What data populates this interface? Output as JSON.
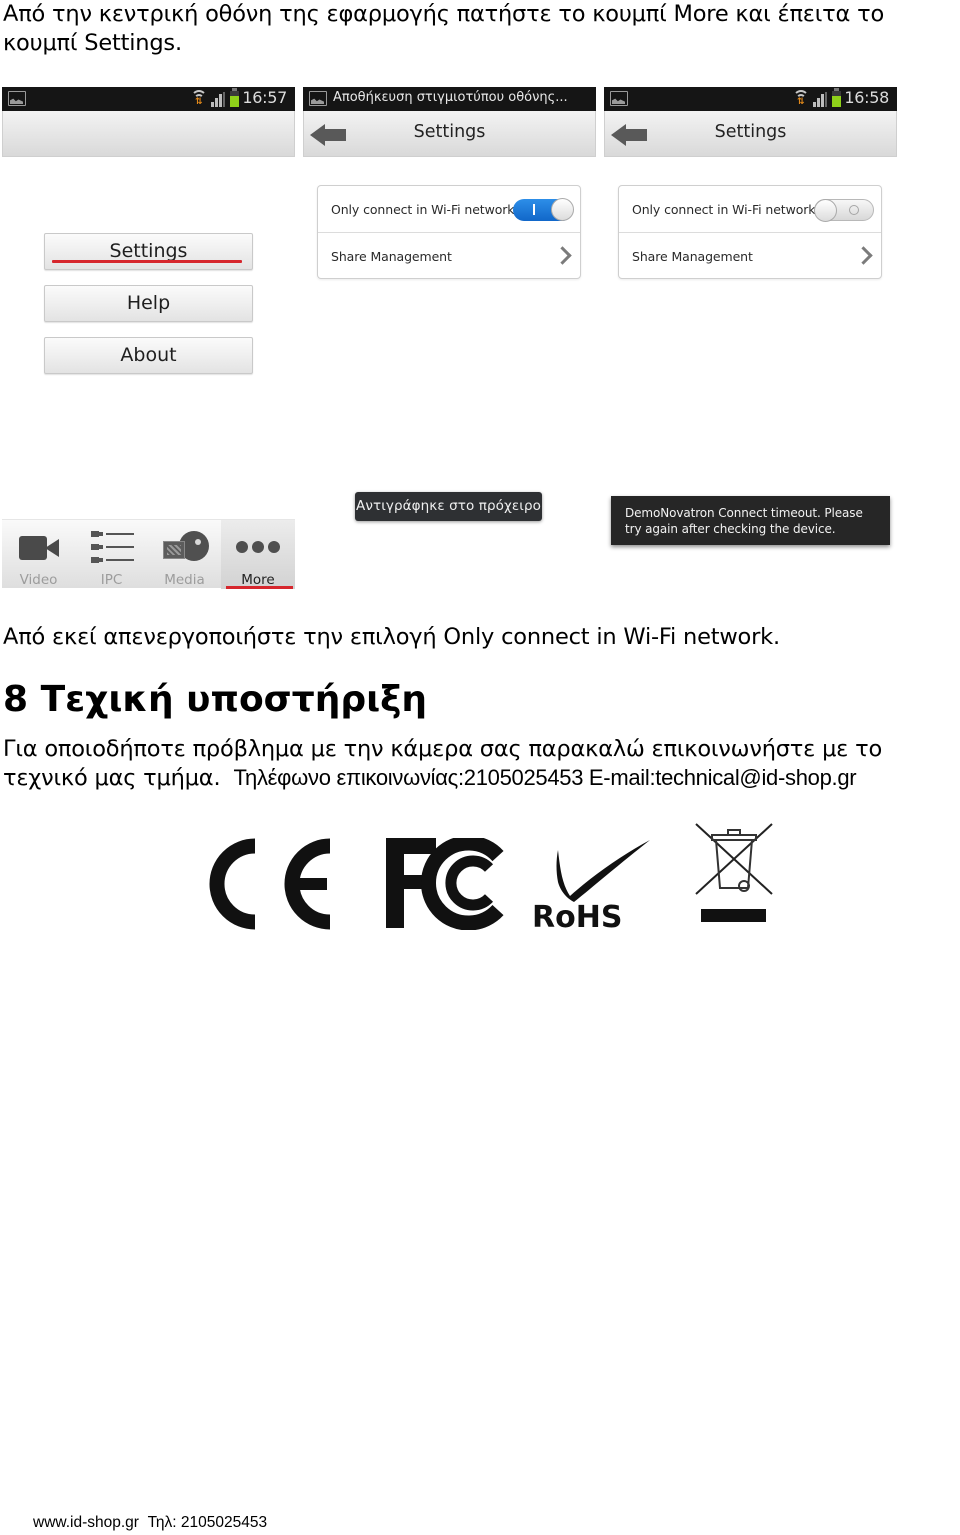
{
  "intro_text_line1": "Από την κεντρική οθόνη της εφαρμογής πατήστε το κουμπί More και έπειτα το",
  "intro_text_line2": "κουμπί Settings.",
  "screens": {
    "screen1": {
      "status_time": "16:57",
      "menu_buttons": [
        {
          "label": "Settings",
          "highlighted": true
        },
        {
          "label": "Help",
          "highlighted": false
        },
        {
          "label": "About",
          "highlighted": false
        }
      ],
      "tabs": [
        {
          "label": "Video",
          "icon": "video-camera-icon",
          "active": false
        },
        {
          "label": "IPC",
          "icon": "camera-list-icon",
          "active": false
        },
        {
          "label": "Media",
          "icon": "media-icon",
          "active": false
        },
        {
          "label": "More",
          "icon": "more-dots-icon",
          "active": true
        }
      ]
    },
    "screen2": {
      "notification_text": "Αποθήκευση στιγμιοτύπου οθόνης...",
      "title": "Settings",
      "rows": [
        {
          "label": "Only connect in Wi-Fi network",
          "type": "toggle",
          "value": true
        },
        {
          "label": "Share Management",
          "type": "link"
        }
      ],
      "toast": "Αντιγράφηκε στο πρόχειρο"
    },
    "screen3": {
      "status_time": "16:58",
      "title": "Settings",
      "rows": [
        {
          "label": "Only connect in Wi-Fi network",
          "type": "toggle",
          "value": false
        },
        {
          "label": "Share Management",
          "type": "link"
        }
      ],
      "toast_line1": "DemoNovatron  Connect timeout. Please",
      "toast_line2": "try again after checking the device."
    }
  },
  "instruction_text": "Από εκεί απενεργοποιήστε την επιλογή Only connect in Wi-Fi network.",
  "section": {
    "heading": "8 Τεχική υποστήριξη",
    "body_line1": "Για οποιοδήποτε πρόβλημα με την κάμερα σας παρακαλώ επικοινωνήστε με το",
    "body_line2": "τεχνικό μας τμήμα.",
    "contact": "Τηλέφωνο επικοινωνίας:2105025453 E-mail:technical@id-shop.gr"
  },
  "certifications": [
    {
      "name": "CE",
      "icon": "ce-mark-icon"
    },
    {
      "name": "FCC",
      "icon": "fcc-logo-icon"
    },
    {
      "name": "RoHS",
      "icon": "rohs-logo-icon"
    },
    {
      "name": "WEEE",
      "icon": "weee-crossed-bin-icon"
    }
  ],
  "rohs_text": "RoHS",
  "footer": "www.id-shop.gr  Τηλ: 2105025453",
  "colors": {
    "accent_red": "#d6262d",
    "toggle_blue": "#1a78d8",
    "battery_green": "#8fd11a"
  }
}
